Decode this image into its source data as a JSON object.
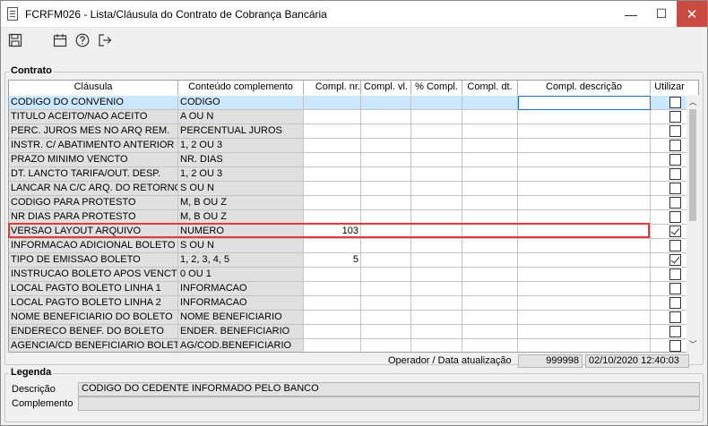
{
  "window": {
    "title": "FCRFM026 - Lista/Cláusula do Contrato de Cobrança Bancária",
    "minimize": "—",
    "maximize": "☐",
    "close": "✕"
  },
  "toolbar": {
    "icons": [
      "save-icon",
      "calendar-icon",
      "help-icon",
      "exit-icon"
    ]
  },
  "contrato": {
    "group_label": "Contrato",
    "columns": [
      "Cláusula",
      "Conteúdo complemento",
      "Compl. nr.",
      "Compl. vl.",
      "% Compl.",
      "Compl. dt.",
      "Compl. descrição",
      "Utilizar"
    ],
    "rows": [
      {
        "clausula": "CODIGO DO CONVENIO",
        "conteudo": "CODIGO",
        "nr": "",
        "utilizar": false
      },
      {
        "clausula": "TITULO ACEITO/NAO ACEITO",
        "conteudo": "A OU N",
        "nr": "",
        "utilizar": false
      },
      {
        "clausula": "PERC. JUROS MES NO ARQ REM.",
        "conteudo": "PERCENTUAL JUROS",
        "nr": "",
        "utilizar": false
      },
      {
        "clausula": "INSTR. C/ ABATIMENTO ANTERIOR",
        "conteudo": "1, 2 OU 3",
        "nr": "",
        "utilizar": false
      },
      {
        "clausula": "PRAZO MINIMO VENCTO",
        "conteudo": "NR. DIAS",
        "nr": "",
        "utilizar": false
      },
      {
        "clausula": "DT. LANCTO TARIFA/OUT. DESP.",
        "conteudo": "1, 2 OU 3",
        "nr": "",
        "utilizar": false
      },
      {
        "clausula": "LANCAR NA C/C ARQ. DO RETORNO",
        "conteudo": "S OU N",
        "nr": "",
        "utilizar": false
      },
      {
        "clausula": "CODIGO PARA PROTESTO",
        "conteudo": "M, B OU Z",
        "nr": "",
        "utilizar": false
      },
      {
        "clausula": "NR DIAS PARA PROTESTO",
        "conteudo": "M, B OU Z",
        "nr": "",
        "utilizar": false
      },
      {
        "clausula": "VERSAO LAYOUT ARQUIVO",
        "conteudo": "NUMERO",
        "nr": "103",
        "utilizar": true
      },
      {
        "clausula": "INFORMACAO ADICIONAL BOLETO",
        "conteudo": "S OU N",
        "nr": "",
        "utilizar": false
      },
      {
        "clausula": "TIPO DE EMISSAO BOLETO",
        "conteudo": "1, 2,  3, 4, 5",
        "nr": "5",
        "utilizar": true
      },
      {
        "clausula": "INSTRUCAO BOLETO APOS VENCTO",
        "conteudo": "0 OU 1",
        "nr": "",
        "utilizar": false
      },
      {
        "clausula": "LOCAL PAGTO BOLETO LINHA 1",
        "conteudo": "INFORMACAO",
        "nr": "",
        "utilizar": false
      },
      {
        "clausula": "LOCAL PAGTO BOLETO LINHA 2",
        "conteudo": "INFORMACAO",
        "nr": "",
        "utilizar": false
      },
      {
        "clausula": "NOME BENEFICIARIO DO BOLETO",
        "conteudo": "NOME BENEFICIARIO",
        "nr": "",
        "utilizar": false
      },
      {
        "clausula": "ENDERECO BENEF. DO BOLETO",
        "conteudo": "ENDER. BENEFICIARIO",
        "nr": "",
        "utilizar": false
      },
      {
        "clausula": "AGENCIA/CD BENEFICIARIO BOLETO",
        "conteudo": "AG/COD.BENEFICIARIO",
        "nr": "",
        "utilizar": false
      }
    ]
  },
  "status": {
    "label": "Operador / Data atualização",
    "operador": "999998",
    "data": "02/10/2020 12:40:03"
  },
  "legenda": {
    "group_label": "Legenda",
    "descricao_label": "Descrição",
    "descricao_value": "CODIGO DO CEDENTE INFORMADO PELO BANCO",
    "complemento_label": "Complemento",
    "complemento_value": ""
  },
  "scrollbar": {
    "up": "︿",
    "down": "﹀"
  }
}
